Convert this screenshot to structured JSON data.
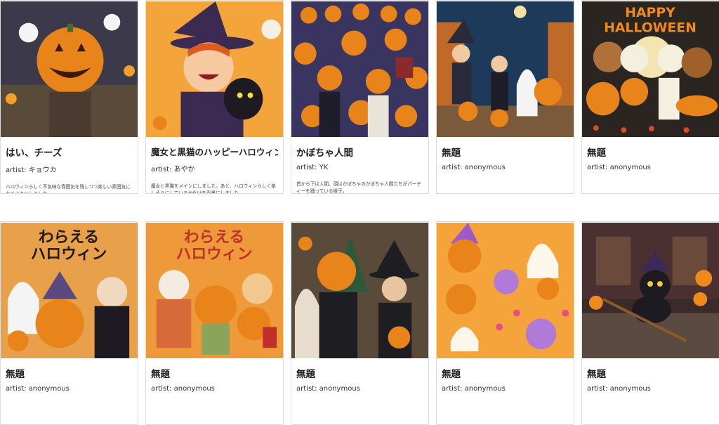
{
  "artist_prefix": "artist: ",
  "cards": [
    {
      "title": "はい、チーズ",
      "artist": "artist: キョウカ",
      "desc": "ハロウィンらしく不気味な雰囲気を残しつつ楽しい雰囲気になるようにしました。"
    },
    {
      "title": "魔女と黒猫のハッピーハロウィン！",
      "artist": "artist: あやか",
      "desc": "魔女と黒猫をメインにしました。あと、ハロウィンらしく楽しそうにしているお化けを背景にしました。"
    },
    {
      "title": "かぼちゃ人間",
      "artist": "artist: YK",
      "desc": "首から下は人間、頭はかぼちゃのかぼちゃ人間たちがパーティーを踊っている様子。"
    },
    {
      "title": "無題",
      "artist": "artist: anonymous",
      "desc": ""
    },
    {
      "title": "無題",
      "artist": "artist: anonymous",
      "desc": ""
    },
    {
      "title": "無題",
      "artist": "artist: anonymous",
      "desc": ""
    },
    {
      "title": "無題",
      "artist": "artist: anonymous",
      "desc": ""
    },
    {
      "title": "無題",
      "artist": "artist: anonymous",
      "desc": ""
    },
    {
      "title": "無題",
      "artist": "artist: anonymous",
      "desc": ""
    },
    {
      "title": "無題",
      "artist": "artist: anonymous",
      "desc": ""
    }
  ],
  "image_text": {
    "happy_halloween_1": "HAPPY",
    "happy_halloween_2": "HALLOWEEN",
    "warau_1": "わらえる",
    "warau_2": "ハロウィン"
  },
  "colors": {
    "pumpkin": "#f08a1c",
    "night": "#2a2540",
    "card_border": "#dcdcdc"
  }
}
